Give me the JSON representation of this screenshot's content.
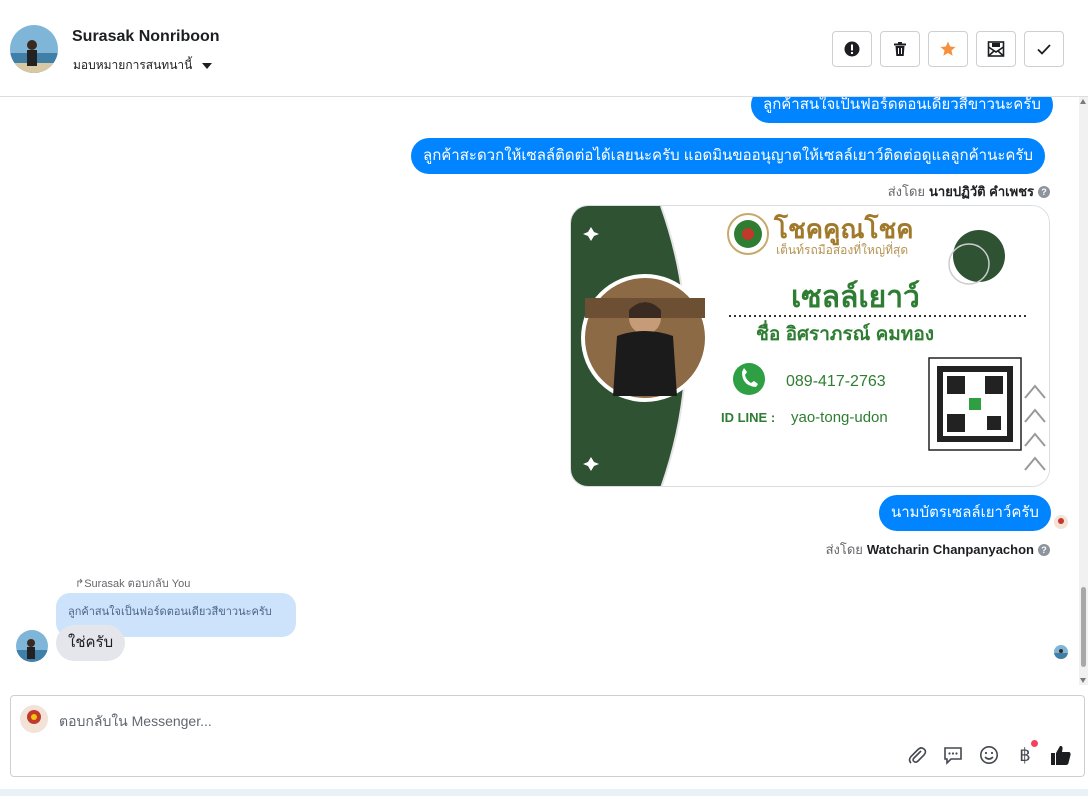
{
  "header": {
    "contact_name": "Surasak Nonriboon",
    "assign_label": "มอบหมายการสนทนานี้",
    "actions": [
      {
        "icon": "alert-icon",
        "label": "spam"
      },
      {
        "icon": "trash-icon",
        "label": "delete"
      },
      {
        "icon": "star-icon",
        "label": "follow up",
        "color": "#f5913e"
      },
      {
        "icon": "mark-unread-icon",
        "label": "unread"
      },
      {
        "icon": "check-icon",
        "label": "done"
      }
    ]
  },
  "messages": {
    "msg1": "ลูกค้าสนใจเป็นฟอร์ดตอนเดียวสีขาวนะครับ",
    "msg2": "ลูกค้าสะดวกให้เซลล์ติดต่อได้เลยนะครับ แอดมินขออนุญาตให้เซลล์เยาว์ติดต่อดูแลลูกค้านะครับ",
    "sent_by_prefix": "ส่งโดย",
    "sent_by_1": "นายปฏิวัติ คำเพชร",
    "msg3": "นามบัตรเซลล์เยาว์ครับ",
    "sent_by_2": "Watcharin Chanpanyachon",
    "reply_hint": "Surasak ตอบกลับ You",
    "quoted": "ลูกค้าสนใจเป็นฟอร์ดตอนเดียวสีขาวนะครับ",
    "reply": "ใช่ครับ"
  },
  "card": {
    "brand": "โชคคูณโชค",
    "tagline": "เต็นท์รถมือสองที่ใหญ่ที่สุด",
    "title": "เซลล์เยาว์",
    "name_line": "ชื่อ อิศราภรณ์  คมทอง",
    "phone": "089-417-2763",
    "line_label": "ID LINE :",
    "line_id": "yao-tong-udon",
    "colors": {
      "green": "#2f5233",
      "text_green": "#2e7d32",
      "gold": "#a07a2a"
    }
  },
  "composer": {
    "placeholder": "ตอบกลับใน Messenger...",
    "tools": [
      "paperclip-icon",
      "saved-reply-icon",
      "emoji-icon",
      "baht-icon",
      "thumbs-up-icon"
    ],
    "baht_symbol": "฿"
  },
  "colors": {
    "accent": "#0084ff",
    "incoming": "#e4e6eb",
    "quoted": "#cde2fb"
  }
}
